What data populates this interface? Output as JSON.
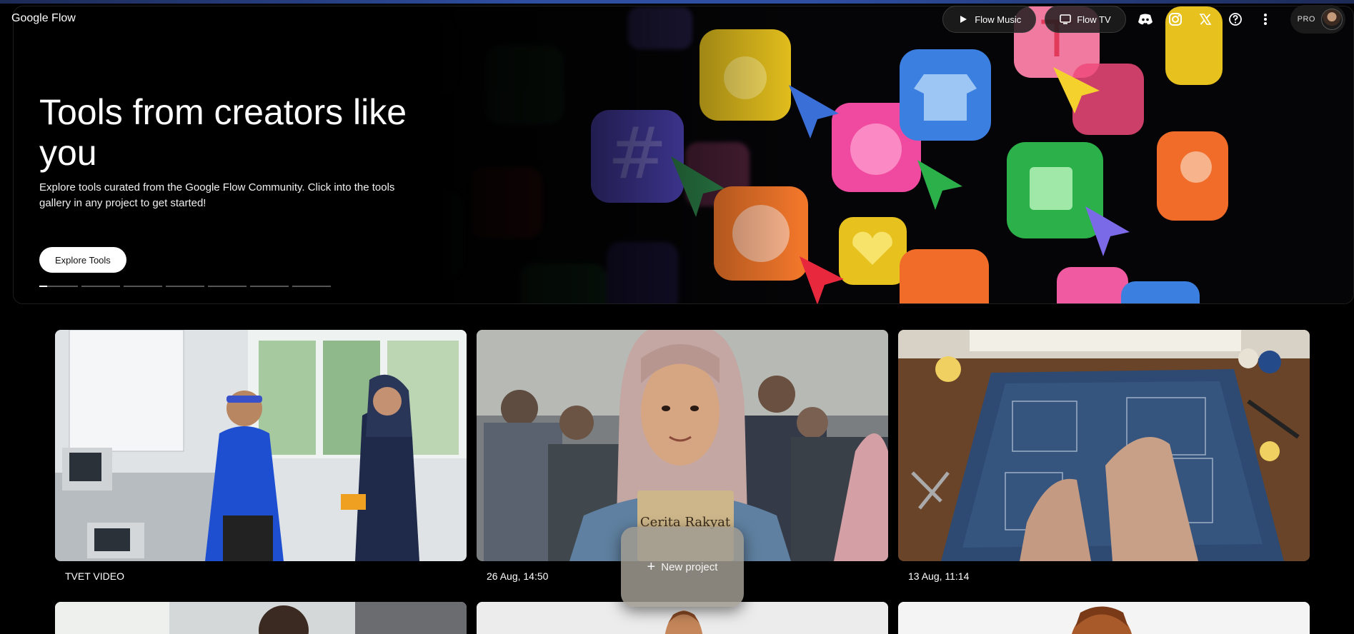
{
  "header": {
    "brand": "Google Flow",
    "flow_music": "Flow Music",
    "flow_tv": "Flow TV",
    "pro_badge": "PRO"
  },
  "hero": {
    "title": "Tools from creators like you",
    "description": "Explore tools curated from the Google Flow Community. Click into the tools gallery in any project to get started!",
    "cta": "Explore Tools",
    "slides": 7,
    "active_slide": 1
  },
  "projects": [
    {
      "label": "TVET VIDEO"
    },
    {
      "label": "26 Aug, 14:50"
    },
    {
      "label": "13 Aug, 11:14"
    }
  ],
  "new_project": {
    "label": "New project"
  },
  "icons": {
    "music": "music-icon",
    "tv": "tv-icon",
    "discord": "discord-icon",
    "instagram": "instagram-icon",
    "x": "x-icon",
    "help": "help-icon",
    "more": "more-vert-icon"
  }
}
